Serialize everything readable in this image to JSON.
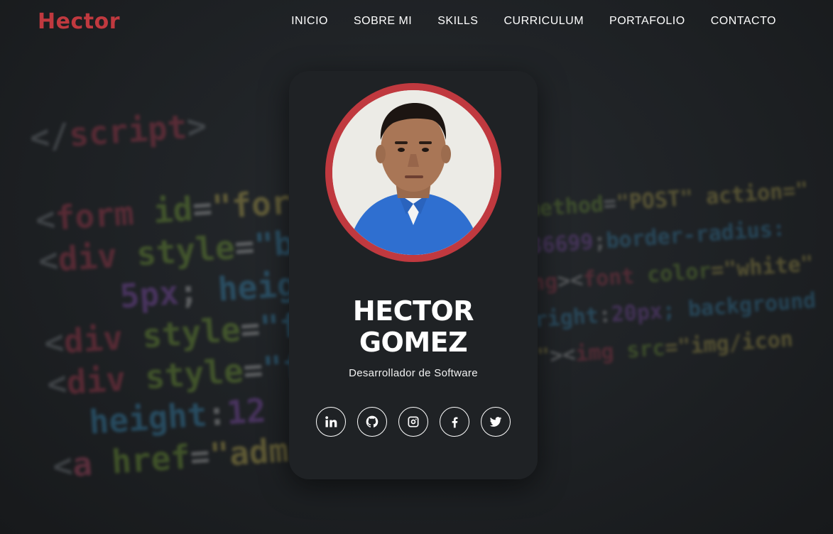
{
  "navbar": {
    "brand": "Hector",
    "links": [
      "INICIO",
      "SOBRE MI",
      "SKILLS",
      "CURRICULUM",
      "PORTAFOLIO",
      "CONTACTO"
    ]
  },
  "profile": {
    "name_line1": "HECTOR",
    "name_line2": "GOMEZ",
    "role": "Desarrollador de Software"
  },
  "socials": [
    "linkedin-icon",
    "github-icon",
    "instagram-icon",
    "facebook-icon",
    "twitter-icon"
  ],
  "colors": {
    "accent": "#c0393f",
    "background": "#1b1e21",
    "card": "#1f2225"
  }
}
